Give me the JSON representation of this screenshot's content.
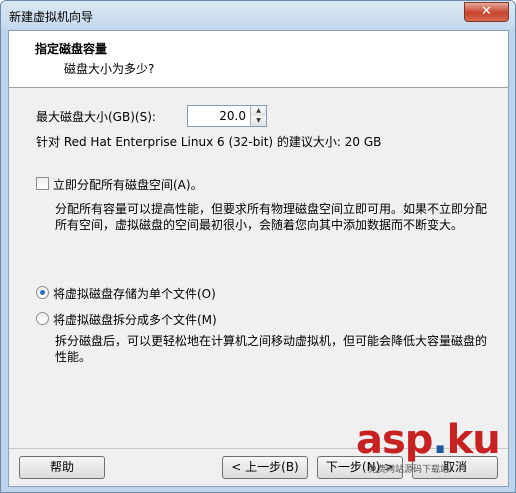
{
  "window": {
    "title": "新建虚拟机向导",
    "close_glyph": "✕"
  },
  "header": {
    "title": "指定磁盘容量",
    "subtitle": "磁盘大小为多少?"
  },
  "disk": {
    "max_size_label": "最大磁盘大小(GB)(S):",
    "max_size_value": "20.0",
    "recommend_text": "针对 Red Hat Enterprise Linux 6 (32-bit) 的建议大小: 20 GB"
  },
  "allocate": {
    "label": "立即分配所有磁盘空间(A)。",
    "checked": false,
    "desc_line1": "分配所有容量可以提高性能，但要求所有物理磁盘空间立即可用。如果不立即分配",
    "desc_line2": "所有空间，虚拟磁盘的空间最初很小，会随着您向其中添加数据而不断变大。"
  },
  "storage": {
    "single_label": "将虚拟磁盘存储为单个文件(O)",
    "single_selected": true,
    "multi_label": "将虚拟磁盘拆分成多个文件(M)",
    "multi_selected": false,
    "multi_desc_line1": "拆分磁盘后，可以更轻松地在计算机之间移动虚拟机，但可能会降低大容量磁盘的",
    "multi_desc_line2": "性能。"
  },
  "buttons": {
    "help": "帮助",
    "back": "< 上一步(B)",
    "next": "下一步(N) >",
    "cancel": "取消"
  },
  "watermark": {
    "brand_a": "asp",
    "brand_dot": ".",
    "brand_b": "ku",
    "tagline": "免费网站源码下载站!"
  }
}
